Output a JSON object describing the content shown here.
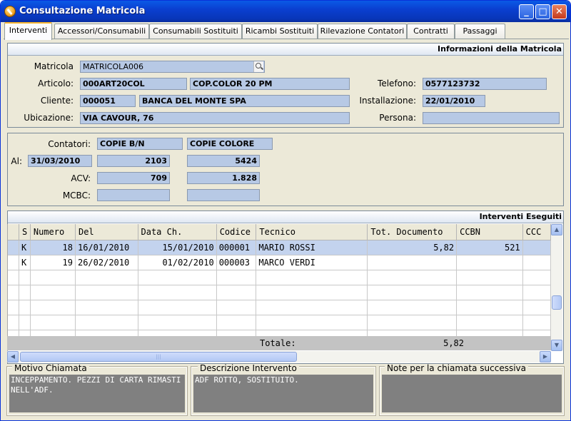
{
  "window": {
    "title": "Consultazione Matricola"
  },
  "tabs": [
    "Interventi",
    "Accessori/Consumabili",
    "Consumabili Sostituiti",
    "Ricambi Sostituiti",
    "Rilevazione Contatori",
    "Contratti",
    "Passaggi"
  ],
  "info": {
    "header": "Informazioni della Matricola",
    "matricola_label": "Matricola",
    "matricola_value": "MATRICOLA006",
    "articolo_label": "Articolo:",
    "articolo_code": "000ART20COL",
    "articolo_desc": "COP.COLOR 20 PM",
    "telefono_label": "Telefono:",
    "telefono_value": "0577123732",
    "cliente_label": "Cliente:",
    "cliente_code": "000051",
    "cliente_name": "BANCA DEL MONTE SPA",
    "installazione_label": "Installazione:",
    "installazione_value": "22/01/2010",
    "ubicazione_label": "Ubicazione:",
    "ubicazione_value": "VIA CAVOUR, 76",
    "persona_label": "Persona:",
    "persona_value": ""
  },
  "contatori": {
    "label": "Contatori:",
    "col1": "COPIE B/N",
    "col2": "COPIE COLORE",
    "al_label": "Al:",
    "al_date": "31/03/2010",
    "al_bn": "2103",
    "al_col": "5424",
    "acv_label": "ACV:",
    "acv_bn": "709",
    "acv_col": "1.828",
    "mcbc_label": "MCBC:",
    "mcbc_bn": "",
    "mcbc_col": ""
  },
  "interventi": {
    "header": "Interventi Eseguiti",
    "columns": [
      "",
      "S",
      "Numero",
      "Del",
      "Data Ch.",
      "Codice",
      "Tecnico",
      "Tot. Documento",
      "CCBN",
      "CCC"
    ],
    "rows": [
      [
        "",
        "K",
        "18",
        "16/01/2010",
        "15/01/2010",
        "000001",
        "MARIO ROSSI",
        "5,82",
        "521",
        ""
      ],
      [
        "",
        "K",
        "19",
        "26/02/2010",
        "01/02/2010",
        "000003",
        "MARCO VERDI",
        "",
        "",
        ""
      ]
    ],
    "totale_label": "Totale:",
    "totale_value": "5,82"
  },
  "motivo": {
    "title": "Motivo Chiamata",
    "text": "INCEPPAMENTO. PEZZI DI CARTA RIMASTI NELL'ADF."
  },
  "descrizione": {
    "title": "Descrizione Intervento",
    "text": "ADF ROTTO, SOSTITUITO."
  },
  "note": {
    "title": "Note per la chiamata successiva",
    "text": ""
  }
}
